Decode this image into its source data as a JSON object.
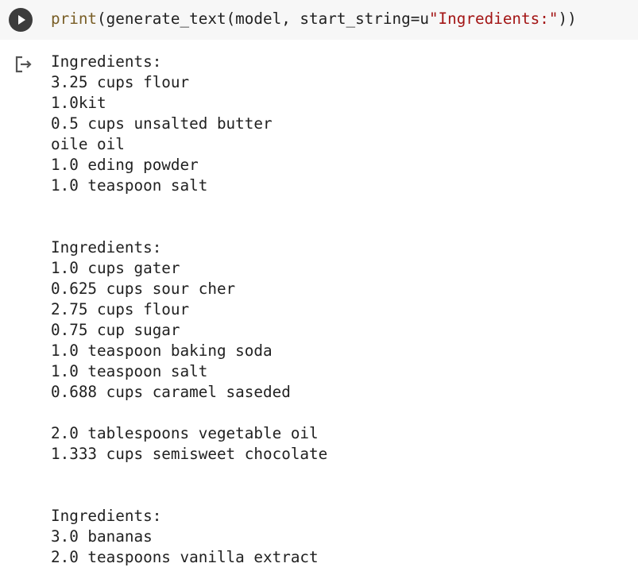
{
  "code_cell": {
    "run_button_icon": "play-icon",
    "code_func": "print",
    "code_middle": "(generate_text(model, start_string=u",
    "code_string": "\"Ingredients:\"",
    "code_end": "))"
  },
  "output": {
    "icon": "output-redirect-icon",
    "lines": [
      "Ingredients:",
      "3.25 cups flour",
      "1.0kit",
      "0.5 cups unsalted butter",
      "oile oil",
      "1.0 eding powder",
      "1.0 teaspoon salt",
      "",
      "",
      "Ingredients:",
      "1.0 cups gater",
      "0.625 cups sour cher",
      "2.75 cups flour",
      "0.75 cup sugar",
      "1.0 teaspoon baking soda",
      "1.0 teaspoon salt",
      "0.688 cups caramel saseded",
      "",
      "2.0 tablespoons vegetable oil",
      "1.333 cups semisweet chocolate",
      "",
      "",
      "Ingredients:",
      "3.0 bananas",
      "2.0 teaspoons vanilla extract"
    ]
  }
}
